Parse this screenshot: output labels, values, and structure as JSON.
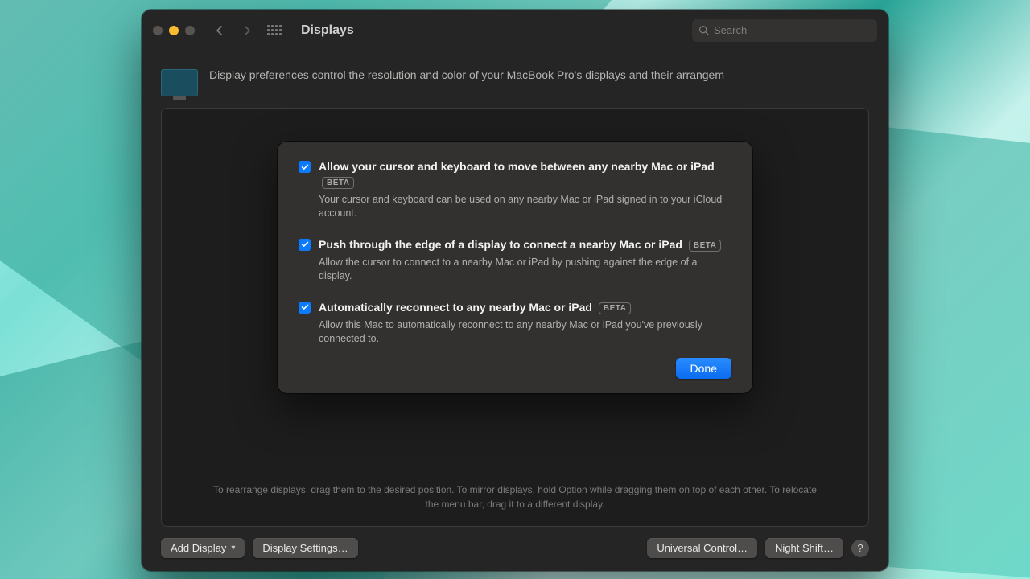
{
  "window": {
    "title": "Displays",
    "search_placeholder": "Search"
  },
  "intro": "Display preferences control the resolution and color of your MacBook Pro's displays and their arrangem",
  "hint": "To rearrange displays, drag them to the desired position. To mirror displays, hold Option while dragging them on top of each other. To relocate the menu bar, drag it to a different display.",
  "buttons": {
    "add_display": "Add Display",
    "display_settings": "Display Settings…",
    "universal_control": "Universal Control…",
    "night_shift": "Night Shift…"
  },
  "sheet": {
    "options": [
      {
        "title": "Allow your cursor and keyboard to move between any nearby Mac or iPad",
        "badge": "BETA",
        "desc": "Your cursor and keyboard can be used on any nearby Mac or iPad signed in to your iCloud account.",
        "checked": true
      },
      {
        "title": "Push through the edge of a display to connect a nearby Mac or iPad",
        "badge": "BETA",
        "desc": "Allow the cursor to connect to a nearby Mac or iPad by pushing against the edge of a display.",
        "checked": true
      },
      {
        "title": "Automatically reconnect to any nearby Mac or iPad",
        "badge": "BETA",
        "desc": "Allow this Mac to automatically reconnect to any nearby Mac or iPad you've previously connected to.",
        "checked": true
      }
    ],
    "done": "Done"
  }
}
